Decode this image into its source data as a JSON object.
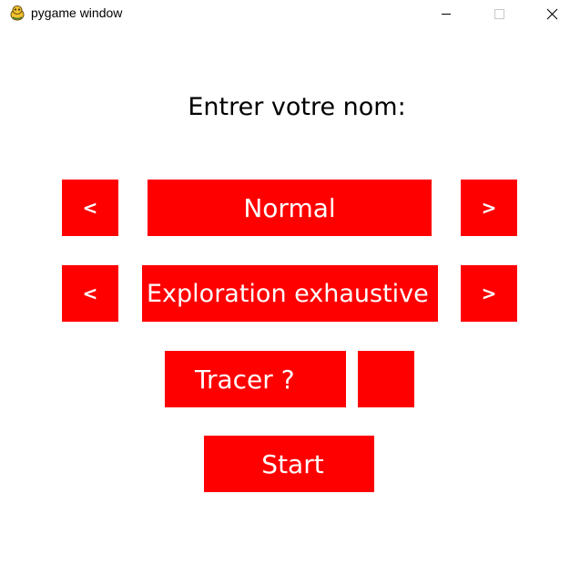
{
  "window": {
    "title": "pygame window",
    "app_icon": "pygame-snake-icon",
    "controls": {
      "minimize_icon": "minimize-icon",
      "maximize_icon": "maximize-icon",
      "close_icon": "close-icon"
    }
  },
  "form": {
    "prompt": "Entrer votre nom:",
    "mode_row": {
      "prev_label": "<",
      "value": "Normal",
      "next_label": ">"
    },
    "algorithm_row": {
      "prev_label": "<",
      "value": "Exploration exhaustive",
      "next_label": ">"
    },
    "trace_row": {
      "label": "Tracer ?",
      "checkbox_checked": false
    },
    "start_label": "Start"
  },
  "colors": {
    "button_background": "#ff0000",
    "button_text": "#ffffff",
    "background": "#ffffff",
    "prompt_text": "#000000"
  }
}
